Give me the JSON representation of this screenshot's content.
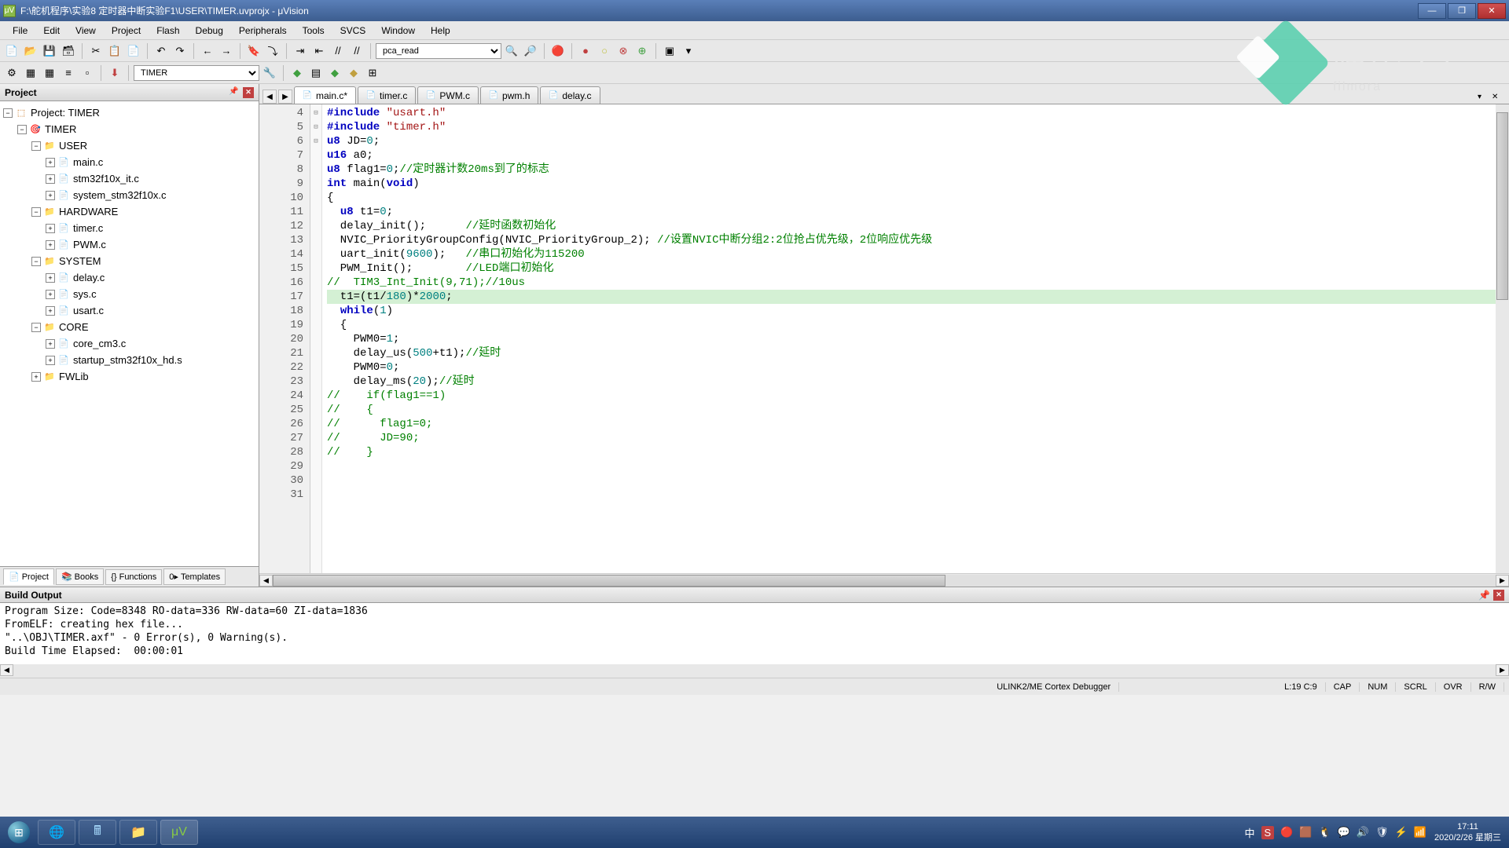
{
  "window": {
    "title": "F:\\舵机程序\\实验8 定时器中断实验F1\\USER\\TIMER.uvprojx - μVision",
    "btn_min": "—",
    "btn_max": "❐",
    "btn_close": "✕"
  },
  "menu": [
    "File",
    "Edit",
    "View",
    "Project",
    "Flash",
    "Debug",
    "Peripherals",
    "Tools",
    "SVCS",
    "Window",
    "Help"
  ],
  "toolbar1": {
    "combo": "pca_read"
  },
  "toolbar2": {
    "target": "TIMER"
  },
  "project_panel": {
    "title": "Project",
    "root": "Project: TIMER",
    "target": "TIMER",
    "groups": [
      {
        "name": "USER",
        "files": [
          "main.c",
          "stm32f10x_it.c",
          "system_stm32f10x.c"
        ],
        "expanded": true
      },
      {
        "name": "HARDWARE",
        "files": [
          "timer.c",
          "PWM.c"
        ],
        "expanded": true
      },
      {
        "name": "SYSTEM",
        "files": [
          "delay.c",
          "sys.c",
          "usart.c"
        ],
        "expanded": true
      },
      {
        "name": "CORE",
        "files": [
          "core_cm3.c",
          "startup_stm32f10x_hd.s"
        ],
        "expanded": true
      },
      {
        "name": "FWLib",
        "files": [],
        "expanded": false
      }
    ],
    "tabs": [
      {
        "icon": "📄",
        "label": "Project",
        "active": true
      },
      {
        "icon": "📚",
        "label": "Books",
        "active": false
      },
      {
        "icon": "{}",
        "label": "Functions",
        "active": false
      },
      {
        "icon": "0▸",
        "label": "Templates",
        "active": false
      }
    ]
  },
  "editor": {
    "tabs": [
      {
        "label": "main.c*",
        "color": "#d4a040",
        "active": true
      },
      {
        "label": "timer.c",
        "color": "#d4a040",
        "active": false
      },
      {
        "label": "PWM.c",
        "color": "#c05050",
        "active": false
      },
      {
        "label": "pwm.h",
        "color": "#8060c0",
        "active": false
      },
      {
        "label": "delay.c",
        "color": "#50a0a0",
        "active": false
      }
    ],
    "first_line": 4,
    "code_lines": [
      "#include \"usart.h\"",
      "#include \"timer.h\"",
      "",
      "u8 JD=0;",
      "u16 a0;",
      "u8 flag1=0;//定时器计数20ms到了的标志",
      "",
      "int main(void)",
      "{",
      "  u8 t1=0;",
      "  delay_init();      //延时函数初始化",
      "  NVIC_PriorityGroupConfig(NVIC_PriorityGroup_2); //设置NVIC中断分组2:2位抢占优先级，2位响应优先级",
      "  uart_init(9600);   //串口初始化为115200",
      "  PWM_Init();        //LED端口初始化",
      "//  TIM3_Int_Init(9,71);//10us",
      "  t1=(t1/180)*2000;",
      "  while(1)",
      "  {",
      "    PWM0=1;",
      "    delay_us(500+t1);//延时",
      "    PWM0=0;",
      "    delay_ms(20);//延时",
      "",
      "//    if(flag1==1)",
      "//    {",
      "//      flag1=0;",
      "//      JD=90;",
      "//    }"
    ],
    "current_line_index": 15
  },
  "build": {
    "title": "Build Output",
    "lines": [
      "Program Size: Code=8348 RO-data=336 RW-data=60 ZI-data=1836",
      "FromELF: creating hex file...",
      "\"..\\OBJ\\TIMER.axf\" - 0 Error(s), 0 Warning(s).",
      "Build Time Elapsed:  00:00:01"
    ]
  },
  "status": {
    "debugger": "ULINK2/ME Cortex Debugger",
    "pos": "L:19 C:9",
    "ind": [
      "CAP",
      "NUM",
      "SCRL",
      "OVR",
      "R/W"
    ]
  },
  "taskbar": {
    "ime": "中",
    "ime2": "S",
    "time": "17:11",
    "date": "2020/2/26 星期三"
  },
  "watermark": {
    "text": "喵影工厂",
    "sub": "filmora"
  }
}
